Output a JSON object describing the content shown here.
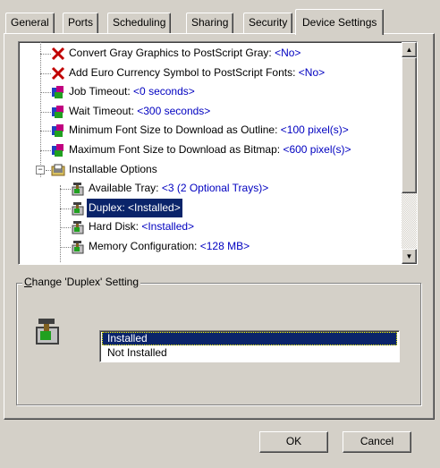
{
  "tabs": [
    {
      "label": "General"
    },
    {
      "label": "Ports"
    },
    {
      "label": "Scheduling"
    },
    {
      "label": "Sharing"
    },
    {
      "label": "Security"
    },
    {
      "label": "Device Settings"
    }
  ],
  "tree": {
    "items": [
      {
        "label": "Convert Gray Graphics to PostScript Gray: ",
        "value": "<No>",
        "icon": "red-x-icon"
      },
      {
        "label": "Add Euro Currency Symbol to PostScript Fonts: ",
        "value": "<No>",
        "icon": "red-x-icon"
      },
      {
        "label": "Job Timeout: ",
        "value": "<0 seconds>",
        "icon": "gear-setting-icon"
      },
      {
        "label": "Wait Timeout: ",
        "value": "<300 seconds>",
        "icon": "gear-setting-icon"
      },
      {
        "label": "Minimum Font Size to Download as Outline: ",
        "value": "<100 pixel(s)>",
        "icon": "gear-setting-icon"
      },
      {
        "label": "Maximum Font Size to Download as Bitmap: ",
        "value": "<600 pixel(s)>",
        "icon": "gear-setting-icon"
      },
      {
        "label": "Installable Options",
        "value": "",
        "icon": "printer-folder-icon"
      },
      {
        "label": "Available Tray: ",
        "value": "<3 (2 Optional Trays)>",
        "icon": "hammer-option-icon"
      },
      {
        "label": "Duplex: ",
        "value": "<Installed>",
        "icon": "hammer-option-icon"
      },
      {
        "label": "Hard Disk: ",
        "value": "<Installed>",
        "icon": "hammer-option-icon"
      },
      {
        "label": "Memory Configuration: ",
        "value": "<128 MB>",
        "icon": "hammer-option-icon"
      }
    ],
    "expander_minus": "−",
    "scroll_up": "▲",
    "scroll_down": "▼"
  },
  "group": {
    "label_prefix": "C",
    "label_rest": "hange 'Duplex' Setting",
    "icon": "hammer-option-icon",
    "options": [
      "Installed",
      "Not Installed"
    ],
    "selected": "Installed"
  },
  "buttons": {
    "ok": "OK",
    "cancel": "Cancel"
  },
  "colors": {
    "selection": "#0a246a",
    "value_text": "#0000c0",
    "face": "#d4d0c8"
  }
}
